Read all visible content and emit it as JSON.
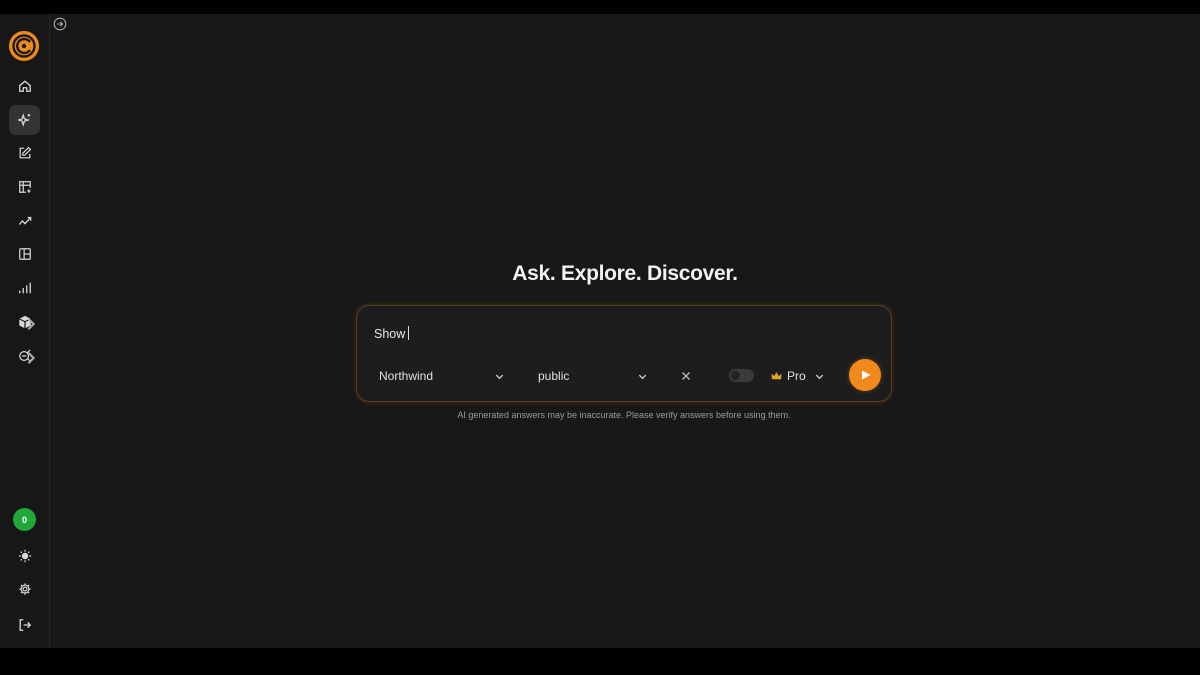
{
  "main": {
    "headline": "Ask. Explore. Discover.",
    "prompt": {
      "value": "Show"
    },
    "database_select": {
      "selected": "Northwind"
    },
    "schema_select": {
      "selected": "public"
    },
    "model_select": {
      "selected": "Pro",
      "icon": "crown-icon"
    },
    "disclaimer": "AI generated answers may be inaccurate. Please verify answers before using them."
  },
  "sidebar": {
    "items": [
      {
        "name": "home",
        "icon": "home-icon"
      },
      {
        "name": "ai-assistant",
        "icon": "sparkles-icon",
        "active": true
      },
      {
        "name": "editor",
        "icon": "edit-icon"
      },
      {
        "name": "tables",
        "icon": "table-add-icon"
      },
      {
        "name": "trends",
        "icon": "trend-icon"
      },
      {
        "name": "layout",
        "icon": "layout-panel-icon"
      },
      {
        "name": "charts",
        "icon": "bar-chart-icon"
      },
      {
        "name": "models",
        "icon": "cube-icon",
        "has_submenu": true
      },
      {
        "name": "integrations",
        "icon": "plugin-icon",
        "has_submenu": true
      }
    ],
    "avatar_label": "0",
    "bottom": [
      "theme-toggle",
      "settings",
      "logout"
    ]
  },
  "colors": {
    "accent": "#f0891e",
    "background": "#181818",
    "sidebar": "#171717",
    "avatar": "#22a83a"
  }
}
